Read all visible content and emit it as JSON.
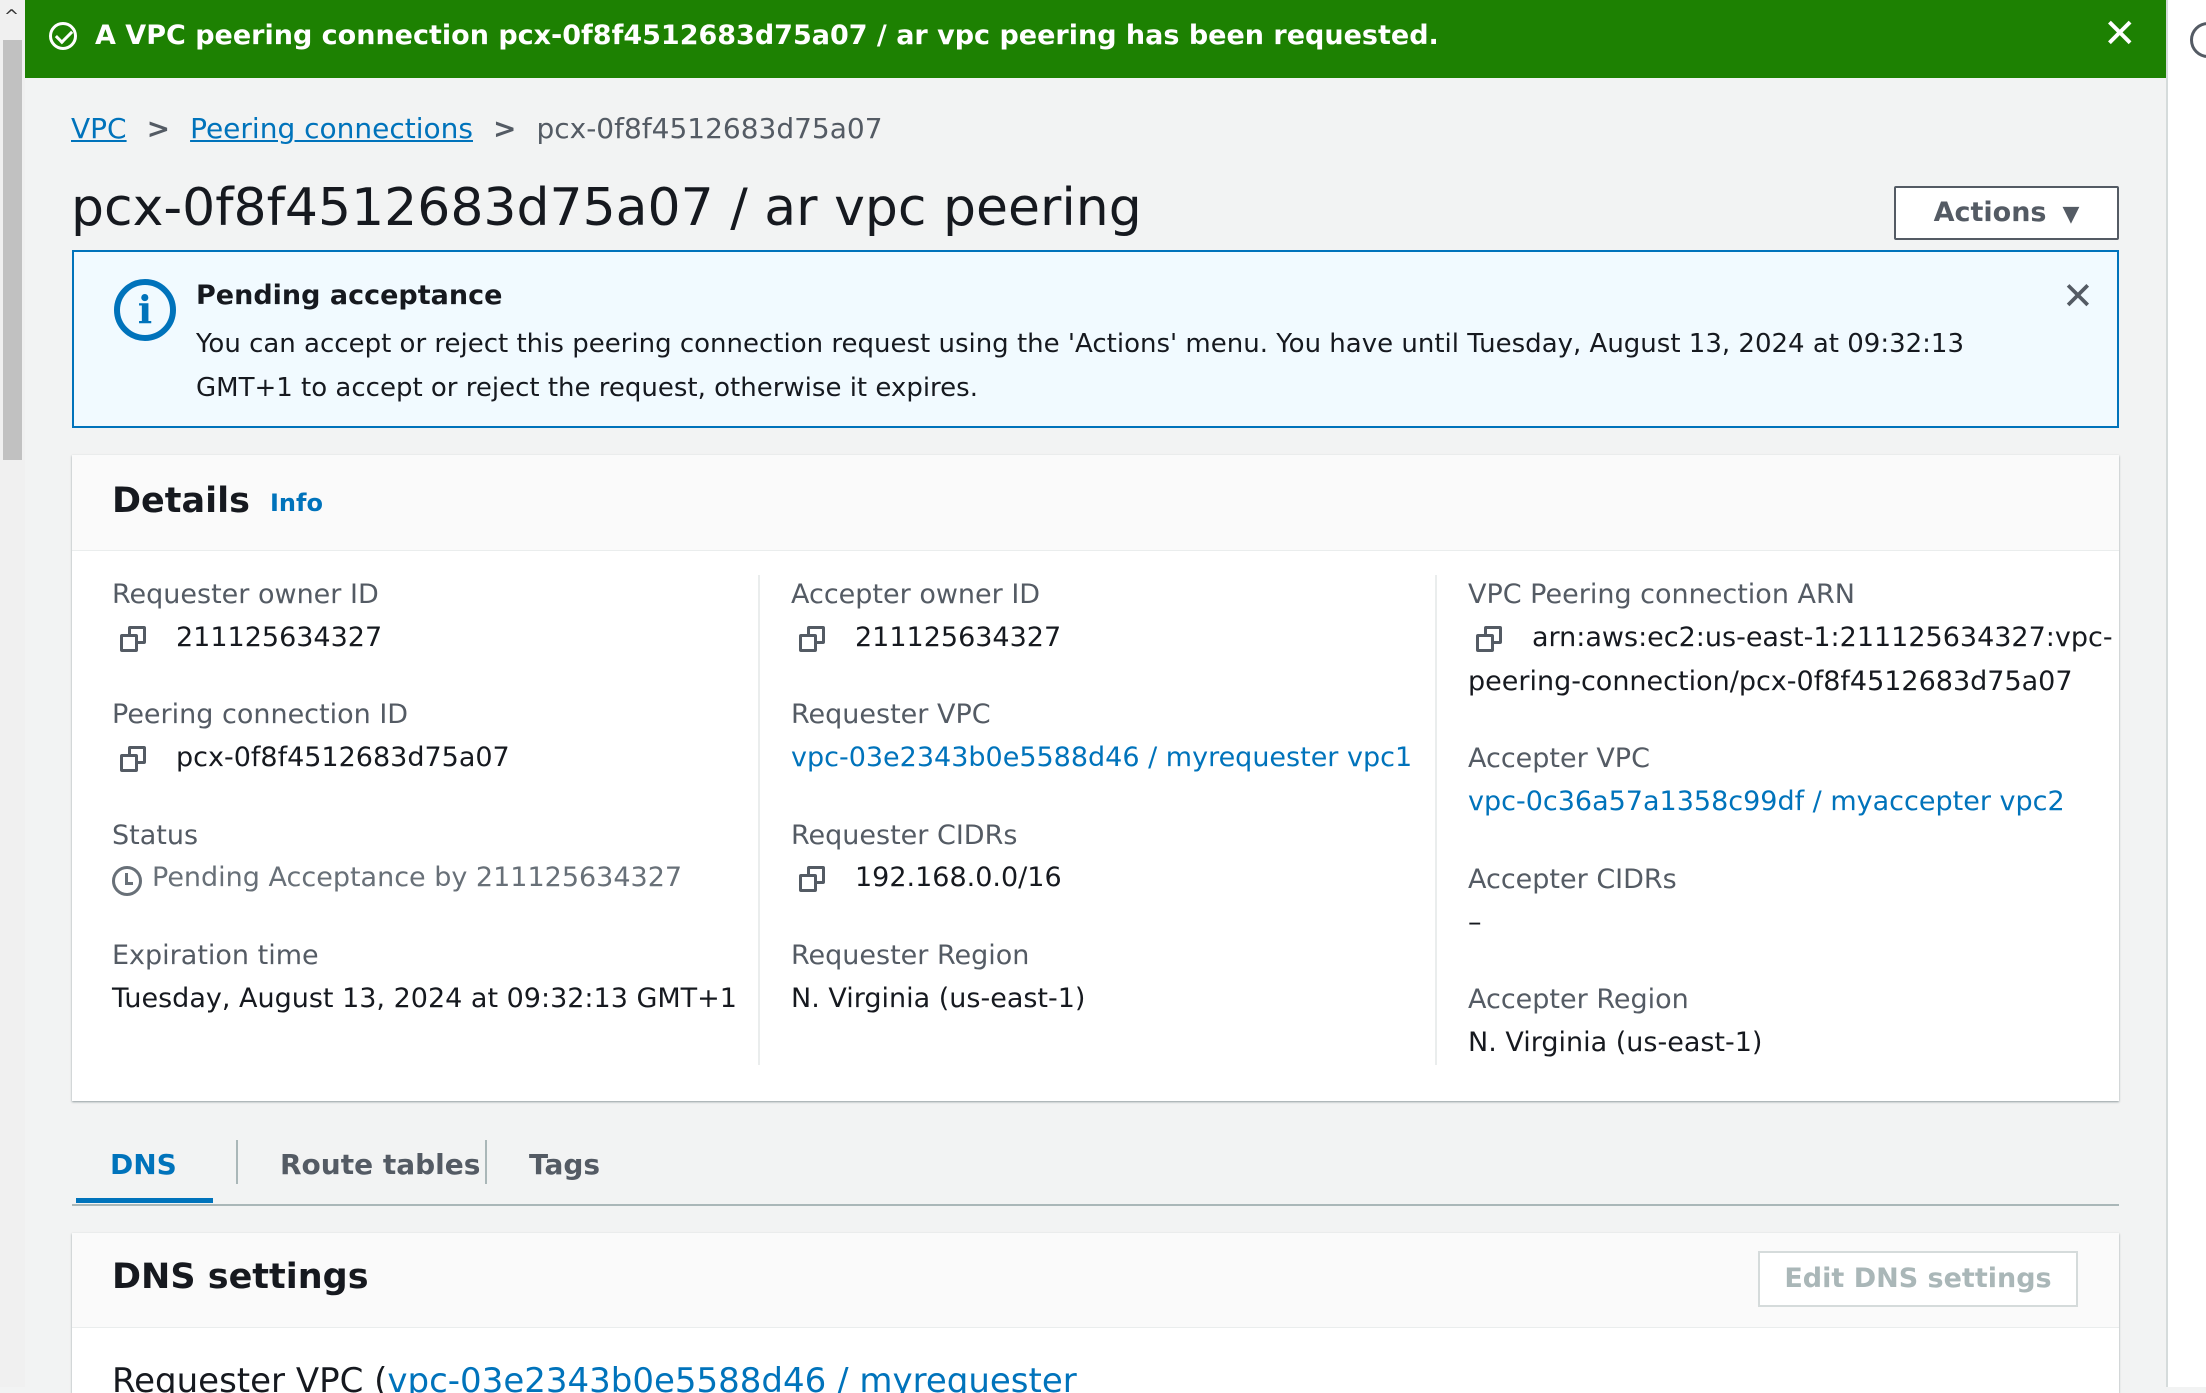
{
  "flash": {
    "message": "A VPC peering connection pcx-0f8f4512683d75a07 / ar vpc peering has been requested."
  },
  "breadcrumb": {
    "items": [
      "VPC",
      "Peering connections",
      "pcx-0f8f4512683d75a07"
    ]
  },
  "page": {
    "title": "pcx-0f8f4512683d75a07 / ar vpc peering",
    "actions_label": "Actions"
  },
  "alert": {
    "heading": "Pending acceptance",
    "body": "You can accept or reject this peering connection request using the 'Actions' menu. You have until Tuesday, August 13, 2024 at 09:32:13 GMT+1 to accept or reject the request, otherwise it expires."
  },
  "details": {
    "title": "Details",
    "info_label": "Info",
    "requester_owner_id": {
      "label": "Requester owner ID",
      "value": "211125634327"
    },
    "peering_connection_id": {
      "label": "Peering connection ID",
      "value": "pcx-0f8f4512683d75a07"
    },
    "status": {
      "label": "Status",
      "value": "Pending Acceptance by 211125634327"
    },
    "expiration_time": {
      "label": "Expiration time",
      "value": "Tuesday, August 13, 2024 at 09:32:13 GMT+1"
    },
    "accepter_owner_id": {
      "label": "Accepter owner ID",
      "value": "211125634327"
    },
    "requester_vpc": {
      "label": "Requester VPC",
      "value": "vpc-03e2343b0e5588d46 / myrequester vpc1"
    },
    "requester_cidrs": {
      "label": "Requester CIDRs",
      "value": "192.168.0.0/16"
    },
    "requester_region": {
      "label": "Requester Region",
      "value": "N. Virginia (us-east-1)"
    },
    "arn": {
      "label": "VPC Peering connection ARN",
      "value_line1": "arn:aws:ec2:us-east-1:211125634327:vpc-",
      "value_line2": "peering-connection/pcx-0f8f4512683d75a07"
    },
    "accepter_vpc": {
      "label": "Accepter VPC",
      "value": "vpc-0c36a57a1358c99df / myaccepter vpc2"
    },
    "accepter_cidrs": {
      "label": "Accepter CIDRs",
      "value": "–"
    },
    "accepter_region": {
      "label": "Accepter Region",
      "value": "N. Virginia (us-east-1)"
    }
  },
  "tabs": [
    "DNS",
    "Route tables",
    "Tags"
  ],
  "dns": {
    "title": "DNS settings",
    "edit_label": "Edit DNS settings",
    "sub_prefix": "Requester VPC (",
    "sub_link": "vpc-03e2343b0e5588d46 / myrequester"
  },
  "colors": {
    "success": "#1d8102",
    "link": "#0073bb",
    "info_bg": "#f1faff"
  }
}
